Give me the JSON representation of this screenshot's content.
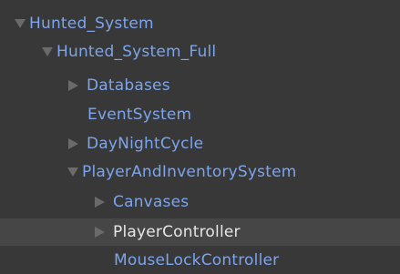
{
  "hierarchy": {
    "items": [
      {
        "label": "Hunted_System",
        "state": "expanded",
        "depth": 0,
        "color": "#7ca5ec"
      },
      {
        "label": "Hunted_System_Full",
        "state": "expanded",
        "depth": 1,
        "color": "#7ca5ec"
      },
      {
        "label": "Databases",
        "state": "collapsed",
        "depth": 2,
        "color": "#7ca5ec"
      },
      {
        "label": "EventSystem",
        "state": "leaf",
        "depth": 2,
        "color": "#7ca5ec"
      },
      {
        "label": "DayNightCycle",
        "state": "collapsed",
        "depth": 2,
        "color": "#7ca5ec"
      },
      {
        "label": "PlayerAndInventorySystem",
        "state": "expanded",
        "depth": 2,
        "color": "#7ca5ec"
      },
      {
        "label": "Canvases",
        "state": "collapsed",
        "depth": 3,
        "color": "#7ca5ec"
      },
      {
        "label": "PlayerController",
        "state": "collapsed",
        "depth": 3,
        "color": "#e6e6e6",
        "selected": true
      },
      {
        "label": "MouseLockController",
        "state": "leaf",
        "depth": 3,
        "color": "#7ca5ec"
      }
    ]
  },
  "colors": {
    "background": "#383838",
    "selected_row": "#464646",
    "prefab_text": "#7ca5ec",
    "selected_text": "#e6e6e6",
    "foldout_arrow": "#6a6a6a"
  }
}
